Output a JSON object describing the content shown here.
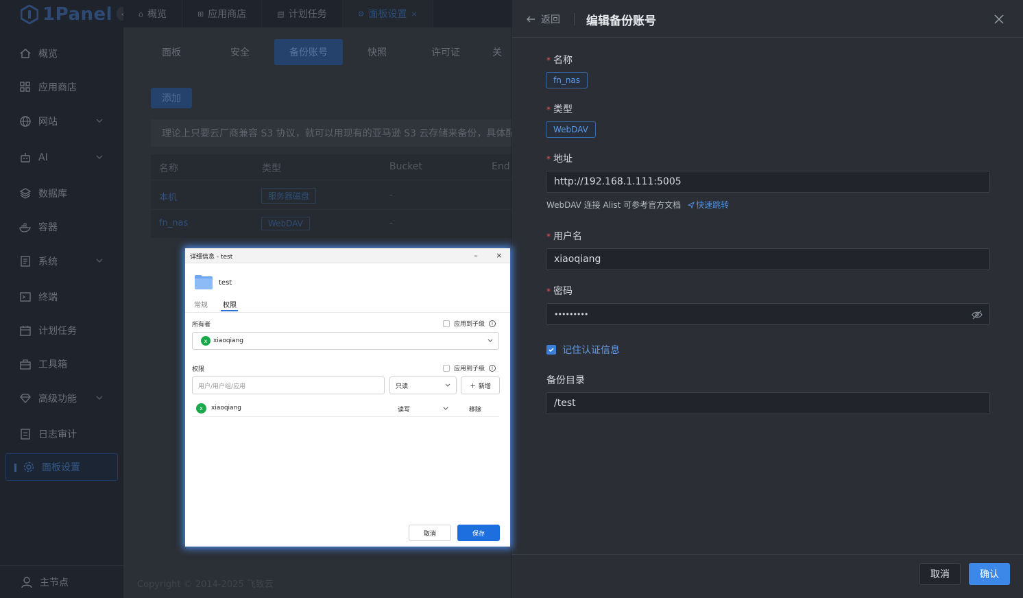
{
  "sidebar": {
    "logo_text": "1Panel",
    "items": [
      {
        "label": "概览",
        "icon": "home-icon"
      },
      {
        "label": "应用商店",
        "icon": "grid-icon"
      },
      {
        "label": "网站",
        "icon": "globe-icon"
      },
      {
        "label": "AI",
        "icon": "robot-icon"
      },
      {
        "label": "数据库",
        "icon": "layers-icon"
      },
      {
        "label": "容器",
        "icon": "docker-icon"
      },
      {
        "label": "系统",
        "icon": "document-icon"
      },
      {
        "label": "终端",
        "icon": "terminal-icon"
      },
      {
        "label": "计划任务",
        "icon": "calendar-icon"
      },
      {
        "label": "工具箱",
        "icon": "toolbox-icon"
      },
      {
        "label": "高级功能",
        "icon": "diamond-icon"
      },
      {
        "label": "日志审计",
        "icon": "log-icon"
      },
      {
        "label": "面板设置",
        "icon": "gear-icon"
      }
    ],
    "bottom_label": "主节点"
  },
  "top_tabs": [
    {
      "label": "概览"
    },
    {
      "label": "应用商店"
    },
    {
      "label": "计划任务"
    },
    {
      "label": "面板设置"
    }
  ],
  "sub_tabs": [
    "面板",
    "安全",
    "备份账号",
    "快照",
    "许可证",
    "关"
  ],
  "main": {
    "add_button": "添加",
    "notice": "理论上只要云厂商兼容 S3 协议，就可以用现有的亚马逊 S3 云存储来备份，具体配",
    "table": {
      "headers": [
        "名称",
        "类型",
        "Bucket",
        "End"
      ],
      "rows": [
        {
          "name": "本机",
          "type": "服务器磁盘",
          "bucket": "-"
        },
        {
          "name": "fn_nas",
          "type": "WebDAV",
          "bucket": "-"
        }
      ]
    },
    "copyright": "Copyright © 2014-2025 飞致云"
  },
  "drawer": {
    "back_label": "返回",
    "title": "编辑备份账号",
    "name_label": "名称",
    "name_value": "fn_nas",
    "type_label": "类型",
    "type_value": "WebDAV",
    "address_label": "地址",
    "address_value": "http://192.168.1.111:5005",
    "hint_text": "WebDAV 连接 Alist 可参考官方文档",
    "hint_link": "快速跳转",
    "username_label": "用户名",
    "username_value": "xiaoqiang",
    "password_label": "密码",
    "password_value": "•••••••••",
    "remember_label": "记住认证信息",
    "remember_checked": true,
    "backup_dir_label": "备份目录",
    "backup_dir_value": "/test",
    "cancel_label": "取消",
    "confirm_label": "确认"
  },
  "dialog": {
    "title": "详细信息 - test",
    "minimize": "–",
    "close": "×",
    "folder_name": "test",
    "tabs": [
      "常规",
      "权限"
    ],
    "owner_label": "所有者",
    "apply_label": "应用到子级",
    "owner_avatar": "x",
    "owner_value": "xiaoqiang",
    "perm_label": "权限",
    "apply_label_2": "应用到子级",
    "user_placeholder": "用户/用户组/应用",
    "perm_select": "只读",
    "add_label": "新增",
    "perm_row": {
      "avatar": "x",
      "user": "xiaoqiang",
      "perm": "读写",
      "remove": "移除"
    },
    "cancel_label": "取消",
    "save_label": "保存"
  },
  "colors": {
    "accent": "#3c88e8",
    "required": "#e05454",
    "dialog_primary": "#1d6fe0",
    "owner_avatar": "#19a94a"
  }
}
